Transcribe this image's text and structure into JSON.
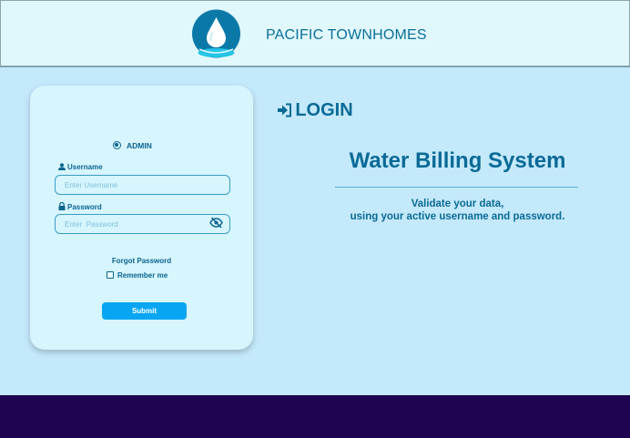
{
  "header": {
    "brand": "PACIFIC TOWNHOMES",
    "logo_icon": "water-drop-logo"
  },
  "login": {
    "title": "LOGIN",
    "role_option": "ADMIN",
    "username_label": "Username",
    "username_placeholder": "Enter Username",
    "username_value": "",
    "password_label": "Password",
    "password_placeholder": "Enter  Password",
    "password_value": "",
    "forgot_link": "Forgot Password",
    "remember_label": "Remember me",
    "remember_checked": false,
    "submit_label": "Submit"
  },
  "info": {
    "title": "Water Billing System",
    "subtitle_line1": "Validate your data,",
    "subtitle_line2": "using your active username and password."
  },
  "colors": {
    "page_bg": "#c4e9fb",
    "header_bg": "#e0f8fb",
    "card_bg": "#d6f5fd",
    "accent": "#0a6a96",
    "button": "#08a6f2",
    "footer": "#1f0452"
  }
}
